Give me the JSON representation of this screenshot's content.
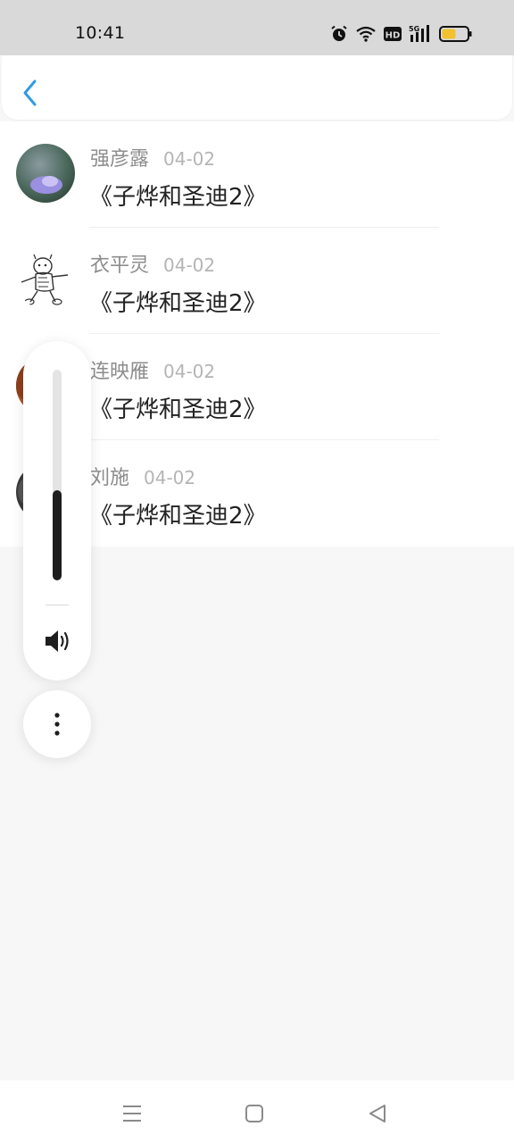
{
  "status_bar": {
    "time": "10:41",
    "icons": [
      "alarm-icon",
      "wifi-icon",
      "hd-icon",
      "signal-5g-icon",
      "battery-icon"
    ],
    "hd_label": "HD",
    "network_label": "5G",
    "battery_level": 0.55,
    "battery_color": "#f2c12e"
  },
  "header": {
    "back_icon": "chevron-left-icon",
    "accent_color": "#2f9be5"
  },
  "items": [
    {
      "name": "强彦露",
      "date": "04-02",
      "title": "《子烨和圣迪2》"
    },
    {
      "name": "衣平灵",
      "date": "04-02",
      "title": "《子烨和圣迪2》"
    },
    {
      "name": "连映雁",
      "date": "04-02",
      "title": "《子烨和圣迪2》"
    },
    {
      "name": "刘施",
      "date": "04-02",
      "title": "《子烨和圣迪2》"
    }
  ],
  "volume_overlay": {
    "level": 0.43,
    "speaker_icon": "speaker-icon",
    "more_icon": "more-vertical-icon"
  },
  "nav_bar": {
    "buttons": [
      "menu-icon",
      "home-square-icon",
      "back-triangle-icon"
    ]
  }
}
